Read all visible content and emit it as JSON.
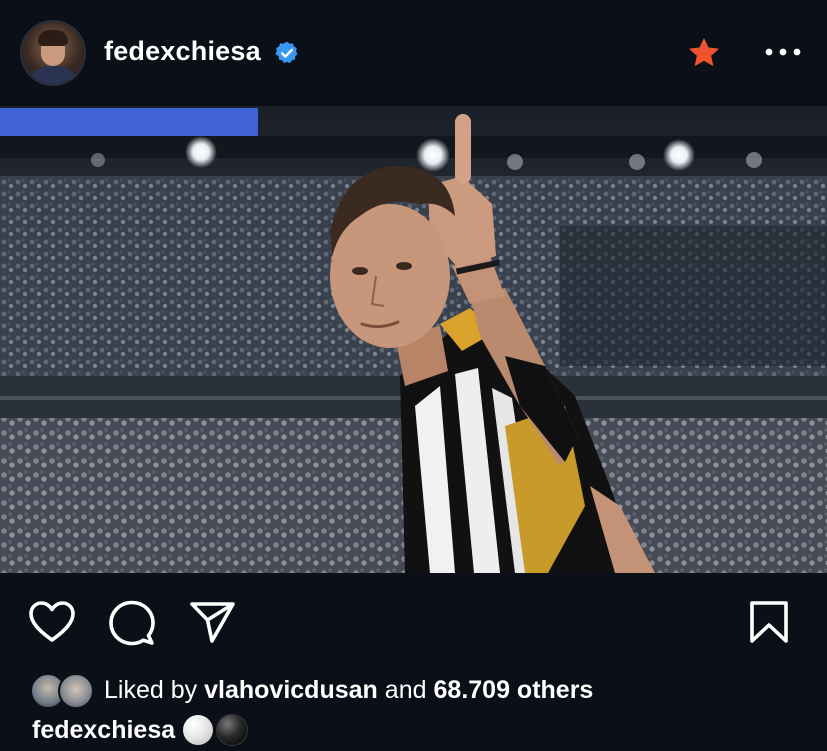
{
  "header": {
    "username": "fedexchiesa",
    "verified": true,
    "avatar_icon": "profile-avatar",
    "favorite_icon": "star-icon",
    "favorite_color": "#f0522d",
    "more_icon": "more-horizontal-icon"
  },
  "post": {
    "image_description_icon": "post-photo"
  },
  "actions": {
    "like_icon": "heart-icon",
    "comment_icon": "comment-icon",
    "share_icon": "send-icon",
    "save_icon": "bookmark-icon"
  },
  "likes": {
    "prefix": "Liked by",
    "user": "vlahovicdusan",
    "connector": "and",
    "count_text": "68.709 others"
  },
  "caption": {
    "author": "fedexchiesa",
    "emoji": [
      "⚪",
      "⚫"
    ]
  },
  "colors": {
    "background": "#0b0f17",
    "text": "#ffffff",
    "verified_blue": "#3897f0"
  }
}
